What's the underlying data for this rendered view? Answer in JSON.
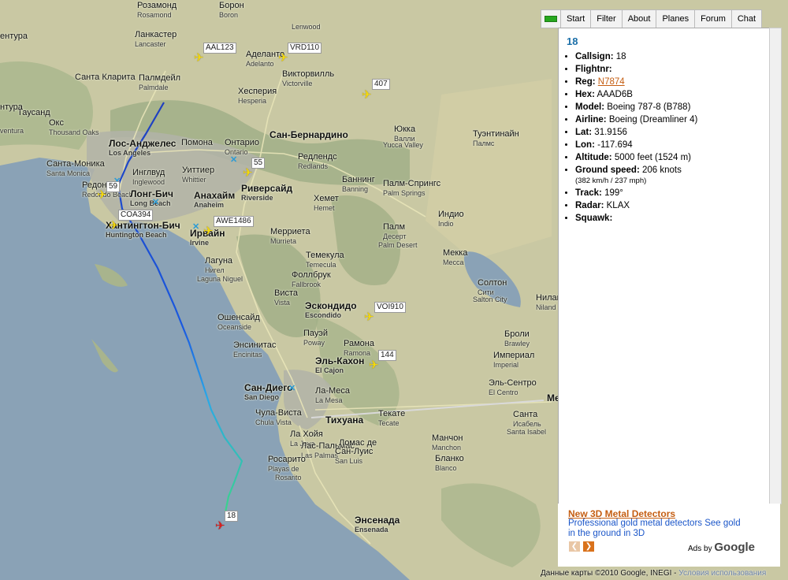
{
  "tabs": [
    "Start",
    "Filter",
    "About",
    "Planes",
    "Forum",
    "Chat"
  ],
  "cities": [
    {
      "id": "rosamond",
      "name": "Розамонд",
      "sub": "Rosamond",
      "cls": ""
    },
    {
      "id": "boron",
      "name": "Борон",
      "sub": "Boron",
      "cls": ""
    },
    {
      "id": "lancaster",
      "name": "Ланкастер",
      "sub": "Lancaster",
      "cls": ""
    },
    {
      "id": "adelanto",
      "name": "Аделанто",
      "sub": "Adelanto",
      "cls": ""
    },
    {
      "id": "lenwood",
      "name": "",
      "sub": "Lenwood",
      "cls": ""
    },
    {
      "id": "santa-clarita",
      "name": "Санта Кларита",
      "sub": "",
      "cls": ""
    },
    {
      "id": "palmdale",
      "name": "Палмдейл",
      "sub": "Palmdale",
      "cls": ""
    },
    {
      "id": "victorville",
      "name": "Викторвилль",
      "sub": "Victorville",
      "cls": ""
    },
    {
      "id": "hesperia",
      "name": "Хесперия",
      "sub": "Hesperia",
      "cls": ""
    },
    {
      "id": "tausand",
      "name": "Таусанд",
      "sub": "",
      "cls": ""
    },
    {
      "id": "oks",
      "name": "Окс",
      "sub": "Thousand Oaks",
      "cls": ""
    },
    {
      "id": "nutra",
      "name": "нтура",
      "sub": "",
      "cls": ""
    },
    {
      "id": "ventura",
      "name": "",
      "sub": "ventura",
      "cls": ""
    },
    {
      "id": "los-angeles",
      "name": "Лос-Анджелес",
      "sub": "Los Angeles",
      "cls": "big"
    },
    {
      "id": "pomona",
      "name": "Помона",
      "sub": "",
      "cls": ""
    },
    {
      "id": "ontario",
      "name": "Онтарио",
      "sub": "Ontario",
      "cls": ""
    },
    {
      "id": "san-bernardino",
      "name": "Сан-Бернардино",
      "sub": "",
      "cls": "big"
    },
    {
      "id": "santa-monica",
      "name": "Санта-Моника",
      "sub": "Santa Monica",
      "cls": ""
    },
    {
      "id": "inglewood",
      "name": "Инглвуд",
      "sub": "Inglewood",
      "cls": ""
    },
    {
      "id": "uittier",
      "name": "Уиттиер",
      "sub": "Whittier",
      "cls": ""
    },
    {
      "id": "redlands",
      "name": "Редлендс",
      "sub": "Redlands",
      "cls": ""
    },
    {
      "id": "yucca-valley",
      "name": "Юкка",
      "sub": "Валли",
      "cls": ""
    },
    {
      "id": "yucca-valley-en",
      "name": "",
      "sub": "Yucca Valley",
      "cls": ""
    },
    {
      "id": "twentynine",
      "name": "Туэнтинайн",
      "sub": "Палмс",
      "cls": ""
    },
    {
      "id": "redondo",
      "name": "Редон",
      "sub": "Redondo Beach",
      "cls": ""
    },
    {
      "id": "long-beach",
      "name": "Лонг-Бич",
      "sub": "Long Beach",
      "cls": "big"
    },
    {
      "id": "anaheim",
      "name": "Анахайм",
      "sub": "Anaheim",
      "cls": "big"
    },
    {
      "id": "riverside",
      "name": "Риверсайд",
      "sub": "Riverside",
      "cls": "big"
    },
    {
      "id": "banning",
      "name": "Баннинг",
      "sub": "Banning",
      "cls": ""
    },
    {
      "id": "palm-springs",
      "name": "Палм-Спрингс",
      "sub": "Palm Springs",
      "cls": ""
    },
    {
      "id": "hemet",
      "name": "Хемет",
      "sub": "Hemet",
      "cls": ""
    },
    {
      "id": "indio",
      "name": "Индио",
      "sub": "Indio",
      "cls": ""
    },
    {
      "id": "huntington",
      "name": "Хантингтон-Бич",
      "sub": "Huntington Beach",
      "cls": "big"
    },
    {
      "id": "irvine",
      "name": "Ирвайн",
      "sub": "Irvine",
      "cls": "big"
    },
    {
      "id": "murrieta",
      "name": "Мерриета",
      "sub": "Murrieta",
      "cls": ""
    },
    {
      "id": "palm-desert",
      "name": "Палм",
      "sub": "Десерт",
      "cls": ""
    },
    {
      "id": "palm-desert-en",
      "name": "",
      "sub": "Palm Desert",
      "cls": ""
    },
    {
      "id": "mecca",
      "name": "Мекка",
      "sub": "Mecca",
      "cls": ""
    },
    {
      "id": "laguna",
      "name": "Лагуна",
      "sub": "Нигел",
      "cls": ""
    },
    {
      "id": "laguna-en",
      "name": "",
      "sub": "Laguna Niguel",
      "cls": ""
    },
    {
      "id": "temecula",
      "name": "Темекула",
      "sub": "Temecula",
      "cls": ""
    },
    {
      "id": "fallbrook",
      "name": "Фоллбрук",
      "sub": "Fallbrook",
      "cls": ""
    },
    {
      "id": "salton",
      "name": "Солтон",
      "sub": "Сити",
      "cls": ""
    },
    {
      "id": "salton-en",
      "name": "",
      "sub": "Salton City",
      "cls": ""
    },
    {
      "id": "vista",
      "name": "Виста",
      "sub": "Vista",
      "cls": ""
    },
    {
      "id": "escondido",
      "name": "Эскондидо",
      "sub": "Escondido",
      "cls": "big"
    },
    {
      "id": "oceanside",
      "name": "Ошенсайд",
      "sub": "Oceanside",
      "cls": ""
    },
    {
      "id": "niland",
      "name": "Нилан",
      "sub": "Niland",
      "cls": ""
    },
    {
      "id": "poway",
      "name": "Пауэй",
      "sub": "Poway",
      "cls": ""
    },
    {
      "id": "ramona",
      "name": "Рамона",
      "sub": "Ramona",
      "cls": ""
    },
    {
      "id": "encinitas",
      "name": "Энсинитас",
      "sub": "Encinitas",
      "cls": ""
    },
    {
      "id": "brawley",
      "name": "Броли",
      "sub": "Brawley",
      "cls": ""
    },
    {
      "id": "el-cajon",
      "name": "Эль-Кахон",
      "sub": "El Cajon",
      "cls": "big"
    },
    {
      "id": "imperial",
      "name": "Империал",
      "sub": "Imperial",
      "cls": ""
    },
    {
      "id": "san-diego",
      "name": "Сан-Диего",
      "sub": "San Diego",
      "cls": "big"
    },
    {
      "id": "la-mesa",
      "name": "Ла-Меса",
      "sub": "La Mesa",
      "cls": ""
    },
    {
      "id": "el-centro",
      "name": "Эль-Сентро",
      "sub": "El Centro",
      "cls": ""
    },
    {
      "id": "chula-vista",
      "name": "Чула-Виста",
      "sub": "Chula Vista",
      "cls": ""
    },
    {
      "id": "tijuana",
      "name": "Тихуана",
      "sub": "",
      "cls": "big"
    },
    {
      "id": "tecate",
      "name": "Текате",
      "sub": "Tecate",
      "cls": ""
    },
    {
      "id": "santa-isabel",
      "name": "Санта",
      "sub": "Исабель",
      "cls": ""
    },
    {
      "id": "santa-isabel-en",
      "name": "",
      "sub": "Santa Isabel",
      "cls": ""
    },
    {
      "id": "la-joya",
      "name": "Ла Хойя",
      "sub": "La Joya",
      "cls": ""
    },
    {
      "id": "las-palmas",
      "name": "Лас-Пальмас",
      "sub": "Las Palmas",
      "cls": ""
    },
    {
      "id": "lomas",
      "name": "Ломас де",
      "sub": "",
      "cls": ""
    },
    {
      "id": "san-luis",
      "name": "Сан-Луис",
      "sub": "San Luis",
      "cls": ""
    },
    {
      "id": "manchon",
      "name": "Манчон",
      "sub": "Manchon",
      "cls": ""
    },
    {
      "id": "blanco",
      "name": "Бланко",
      "sub": "Blanco",
      "cls": ""
    },
    {
      "id": "rosarito",
      "name": "Росарито",
      "sub": "Playas de",
      "cls": ""
    },
    {
      "id": "rosarito-en",
      "name": "",
      "sub": "Rosarito",
      "cls": ""
    },
    {
      "id": "ensenada",
      "name": "Энсенада",
      "sub": "Ensenada",
      "cls": "big"
    },
    {
      "id": "santa-barbara-left",
      "name": "ентура",
      "sub": "",
      "cls": ""
    },
    {
      "id": "me",
      "name": "Ме",
      "sub": "",
      "cls": "big"
    }
  ],
  "flights": [
    {
      "tag": "AAL123",
      "selected": false
    },
    {
      "tag": "VRD110",
      "selected": false
    },
    {
      "tag": "407",
      "selected": false
    },
    {
      "tag": "55",
      "selected": false
    },
    {
      "tag": "59",
      "selected": false
    },
    {
      "tag": "COA394",
      "selected": false
    },
    {
      "tag": "AWE1486",
      "selected": false
    },
    {
      "tag": "VOI910",
      "selected": false
    },
    {
      "tag": "144",
      "selected": false
    },
    {
      "tag": "18",
      "selected": true
    }
  ],
  "panel": {
    "title": "18",
    "rows": [
      {
        "label": "Callsign:",
        "value": "18"
      },
      {
        "label": "Flightnr:",
        "value": ""
      },
      {
        "label": "Reg:",
        "value": "N7874",
        "link": true
      },
      {
        "label": "Hex:",
        "value": "AAAD6B"
      },
      {
        "label": "Model:",
        "value": "Boeing 787-8 (B788)"
      },
      {
        "label": "Airline:",
        "value": "Boeing (Dreamliner 4)"
      },
      {
        "label": "Lat:",
        "value": "31.9156"
      },
      {
        "label": "Lon:",
        "value": "-117.694"
      },
      {
        "label": "Altitude:",
        "value": "5000 feet (1524 m)"
      },
      {
        "label": "Ground speed:",
        "value": "206 knots",
        "small": "(382 km/h / 237 mph)"
      },
      {
        "label": "Track:",
        "value": "199°"
      },
      {
        "label": "Radar:",
        "value": "KLAX"
      },
      {
        "label": "Squawk:",
        "value": ""
      }
    ]
  },
  "ad": {
    "title": "New 3D Metal Detectors",
    "text": "Professional gold metal detectors See gold in the ground in 3D",
    "ads_by": "Ads by",
    "google": "Google"
  },
  "footer": {
    "text": "Данные карты ©2010 Google, INEGI -",
    "link": "Условия использования"
  },
  "colors": {
    "plane": "#f5d90a",
    "selected_plane": "#d81e1e",
    "route_start": "#1f3fbf",
    "route_end": "#3cd38a"
  }
}
